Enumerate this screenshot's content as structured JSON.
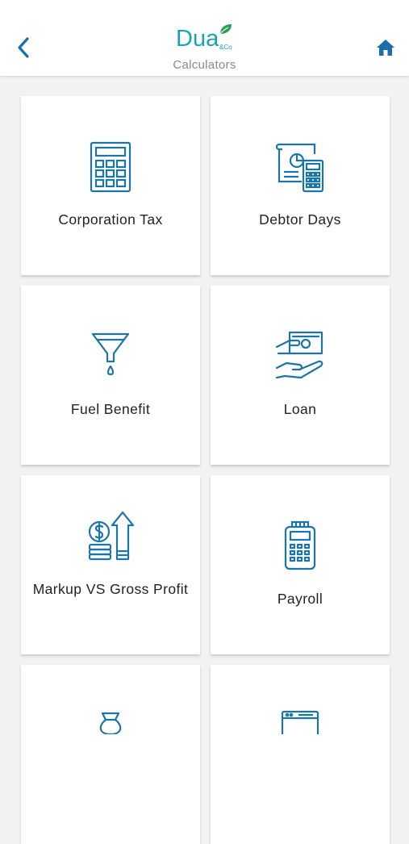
{
  "header": {
    "logo_text": "Dua",
    "logo_suffix": "&Co",
    "title": "Calculators",
    "back_icon": "chevron-left-icon",
    "home_icon": "home-icon"
  },
  "colors": {
    "accent": "#1a6fa8",
    "brand": "#1aa3b5",
    "brand_green": "#2e9d5a",
    "icon_stroke": "#1b75a6"
  },
  "calculators": [
    {
      "label": "Corporation Tax",
      "icon": "calculator-icon"
    },
    {
      "label": "Debtor Days",
      "icon": "invoice-calculator-icon"
    },
    {
      "label": "Fuel Benefit",
      "icon": "funnel-icon"
    },
    {
      "label": "Loan",
      "icon": "hand-cash-icon"
    },
    {
      "label": "Markup VS Gross Profit",
      "icon": "coins-growth-icon"
    },
    {
      "label": "Payroll",
      "icon": "payment-terminal-icon"
    },
    {
      "label": "",
      "icon": "money-bag-icon"
    },
    {
      "label": "",
      "icon": "browser-window-icon"
    }
  ]
}
